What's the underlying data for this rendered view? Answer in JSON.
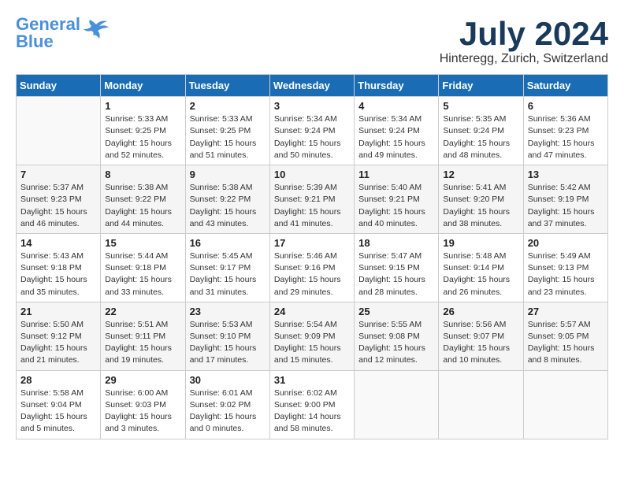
{
  "logo": {
    "line1": "General",
    "line2": "Blue"
  },
  "title": "July 2024",
  "subtitle": "Hinteregg, Zurich, Switzerland",
  "days_of_week": [
    "Sunday",
    "Monday",
    "Tuesday",
    "Wednesday",
    "Thursday",
    "Friday",
    "Saturday"
  ],
  "weeks": [
    [
      {
        "day": "",
        "sunrise": "",
        "sunset": "",
        "daylight": ""
      },
      {
        "day": "1",
        "sunrise": "Sunrise: 5:33 AM",
        "sunset": "Sunset: 9:25 PM",
        "daylight": "Daylight: 15 hours and 52 minutes."
      },
      {
        "day": "2",
        "sunrise": "Sunrise: 5:33 AM",
        "sunset": "Sunset: 9:25 PM",
        "daylight": "Daylight: 15 hours and 51 minutes."
      },
      {
        "day": "3",
        "sunrise": "Sunrise: 5:34 AM",
        "sunset": "Sunset: 9:24 PM",
        "daylight": "Daylight: 15 hours and 50 minutes."
      },
      {
        "day": "4",
        "sunrise": "Sunrise: 5:34 AM",
        "sunset": "Sunset: 9:24 PM",
        "daylight": "Daylight: 15 hours and 49 minutes."
      },
      {
        "day": "5",
        "sunrise": "Sunrise: 5:35 AM",
        "sunset": "Sunset: 9:24 PM",
        "daylight": "Daylight: 15 hours and 48 minutes."
      },
      {
        "day": "6",
        "sunrise": "Sunrise: 5:36 AM",
        "sunset": "Sunset: 9:23 PM",
        "daylight": "Daylight: 15 hours and 47 minutes."
      }
    ],
    [
      {
        "day": "7",
        "sunrise": "Sunrise: 5:37 AM",
        "sunset": "Sunset: 9:23 PM",
        "daylight": "Daylight: 15 hours and 46 minutes."
      },
      {
        "day": "8",
        "sunrise": "Sunrise: 5:38 AM",
        "sunset": "Sunset: 9:22 PM",
        "daylight": "Daylight: 15 hours and 44 minutes."
      },
      {
        "day": "9",
        "sunrise": "Sunrise: 5:38 AM",
        "sunset": "Sunset: 9:22 PM",
        "daylight": "Daylight: 15 hours and 43 minutes."
      },
      {
        "day": "10",
        "sunrise": "Sunrise: 5:39 AM",
        "sunset": "Sunset: 9:21 PM",
        "daylight": "Daylight: 15 hours and 41 minutes."
      },
      {
        "day": "11",
        "sunrise": "Sunrise: 5:40 AM",
        "sunset": "Sunset: 9:21 PM",
        "daylight": "Daylight: 15 hours and 40 minutes."
      },
      {
        "day": "12",
        "sunrise": "Sunrise: 5:41 AM",
        "sunset": "Sunset: 9:20 PM",
        "daylight": "Daylight: 15 hours and 38 minutes."
      },
      {
        "day": "13",
        "sunrise": "Sunrise: 5:42 AM",
        "sunset": "Sunset: 9:19 PM",
        "daylight": "Daylight: 15 hours and 37 minutes."
      }
    ],
    [
      {
        "day": "14",
        "sunrise": "Sunrise: 5:43 AM",
        "sunset": "Sunset: 9:18 PM",
        "daylight": "Daylight: 15 hours and 35 minutes."
      },
      {
        "day": "15",
        "sunrise": "Sunrise: 5:44 AM",
        "sunset": "Sunset: 9:18 PM",
        "daylight": "Daylight: 15 hours and 33 minutes."
      },
      {
        "day": "16",
        "sunrise": "Sunrise: 5:45 AM",
        "sunset": "Sunset: 9:17 PM",
        "daylight": "Daylight: 15 hours and 31 minutes."
      },
      {
        "day": "17",
        "sunrise": "Sunrise: 5:46 AM",
        "sunset": "Sunset: 9:16 PM",
        "daylight": "Daylight: 15 hours and 29 minutes."
      },
      {
        "day": "18",
        "sunrise": "Sunrise: 5:47 AM",
        "sunset": "Sunset: 9:15 PM",
        "daylight": "Daylight: 15 hours and 28 minutes."
      },
      {
        "day": "19",
        "sunrise": "Sunrise: 5:48 AM",
        "sunset": "Sunset: 9:14 PM",
        "daylight": "Daylight: 15 hours and 26 minutes."
      },
      {
        "day": "20",
        "sunrise": "Sunrise: 5:49 AM",
        "sunset": "Sunset: 9:13 PM",
        "daylight": "Daylight: 15 hours and 23 minutes."
      }
    ],
    [
      {
        "day": "21",
        "sunrise": "Sunrise: 5:50 AM",
        "sunset": "Sunset: 9:12 PM",
        "daylight": "Daylight: 15 hours and 21 minutes."
      },
      {
        "day": "22",
        "sunrise": "Sunrise: 5:51 AM",
        "sunset": "Sunset: 9:11 PM",
        "daylight": "Daylight: 15 hours and 19 minutes."
      },
      {
        "day": "23",
        "sunrise": "Sunrise: 5:53 AM",
        "sunset": "Sunset: 9:10 PM",
        "daylight": "Daylight: 15 hours and 17 minutes."
      },
      {
        "day": "24",
        "sunrise": "Sunrise: 5:54 AM",
        "sunset": "Sunset: 9:09 PM",
        "daylight": "Daylight: 15 hours and 15 minutes."
      },
      {
        "day": "25",
        "sunrise": "Sunrise: 5:55 AM",
        "sunset": "Sunset: 9:08 PM",
        "daylight": "Daylight: 15 hours and 12 minutes."
      },
      {
        "day": "26",
        "sunrise": "Sunrise: 5:56 AM",
        "sunset": "Sunset: 9:07 PM",
        "daylight": "Daylight: 15 hours and 10 minutes."
      },
      {
        "day": "27",
        "sunrise": "Sunrise: 5:57 AM",
        "sunset": "Sunset: 9:05 PM",
        "daylight": "Daylight: 15 hours and 8 minutes."
      }
    ],
    [
      {
        "day": "28",
        "sunrise": "Sunrise: 5:58 AM",
        "sunset": "Sunset: 9:04 PM",
        "daylight": "Daylight: 15 hours and 5 minutes."
      },
      {
        "day": "29",
        "sunrise": "Sunrise: 6:00 AM",
        "sunset": "Sunset: 9:03 PM",
        "daylight": "Daylight: 15 hours and 3 minutes."
      },
      {
        "day": "30",
        "sunrise": "Sunrise: 6:01 AM",
        "sunset": "Sunset: 9:02 PM",
        "daylight": "Daylight: 15 hours and 0 minutes."
      },
      {
        "day": "31",
        "sunrise": "Sunrise: 6:02 AM",
        "sunset": "Sunset: 9:00 PM",
        "daylight": "Daylight: 14 hours and 58 minutes."
      },
      {
        "day": "",
        "sunrise": "",
        "sunset": "",
        "daylight": ""
      },
      {
        "day": "",
        "sunrise": "",
        "sunset": "",
        "daylight": ""
      },
      {
        "day": "",
        "sunrise": "",
        "sunset": "",
        "daylight": ""
      }
    ]
  ]
}
